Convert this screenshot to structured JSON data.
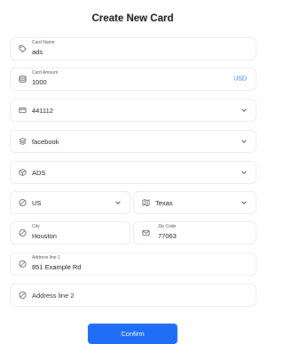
{
  "page": {
    "title": "Create New Card"
  },
  "form": {
    "card_name": {
      "label": "Card Name",
      "value": "ads",
      "icon": "tag-icon"
    },
    "card_amount": {
      "label": "Card Amount",
      "value": "1000",
      "currency": "USD",
      "icon": "coins-icon"
    },
    "bin": {
      "value": "441112",
      "icon": "credit-card-icon"
    },
    "platform": {
      "value": "facebook",
      "icon": "layers-icon"
    },
    "category": {
      "value": "ADS",
      "icon": "box-icon"
    },
    "country": {
      "value": "US",
      "icon": "globe-icon"
    },
    "state": {
      "value": "Texas",
      "icon": "map-icon"
    },
    "city": {
      "label": "City",
      "value": "Houston",
      "icon": "globe-icon"
    },
    "zip": {
      "label": "Zip Code",
      "value": "77063",
      "icon": "mail-icon"
    },
    "address1": {
      "label": "Address line 1",
      "value": "851 Example Rd",
      "icon": "globe-icon"
    },
    "address2": {
      "placeholder": "Address line 2",
      "icon": "globe-icon"
    }
  },
  "actions": {
    "confirm_label": "Confirm"
  },
  "colors": {
    "accent": "#1f6ef5",
    "currency": "#2e7cf6",
    "border": "#ecedef"
  }
}
